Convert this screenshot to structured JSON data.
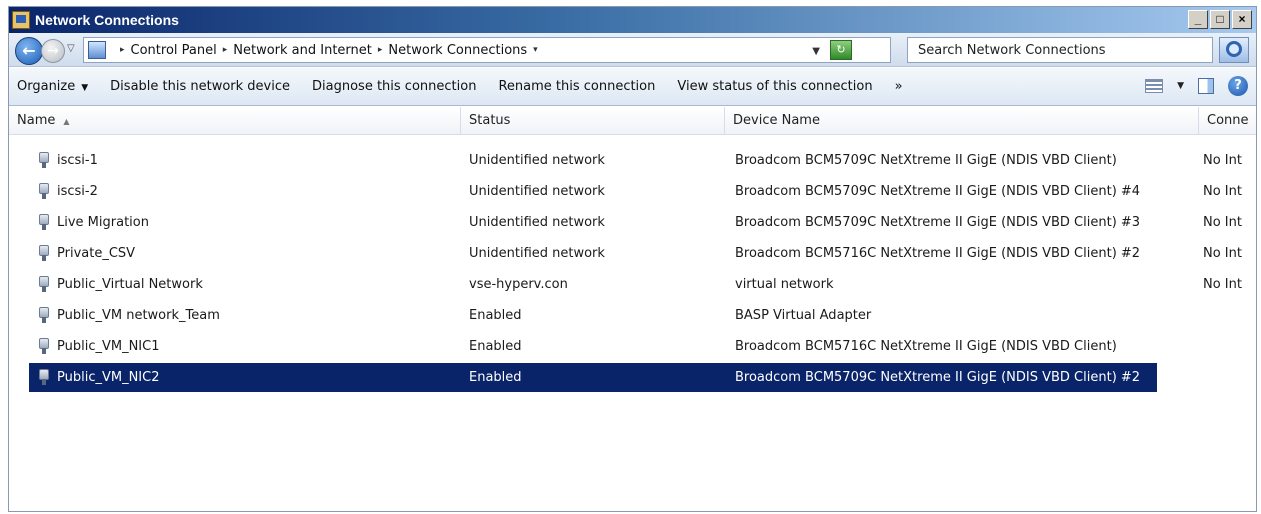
{
  "window": {
    "title": "Network Connections",
    "buttons": {
      "minimize": "_",
      "maximize": "□",
      "close": "×"
    }
  },
  "address": {
    "back_glyph": "←",
    "forward_glyph": "→",
    "breadcrumbs": [
      "Control Panel",
      "Network and Internet",
      "Network Connections"
    ],
    "search_placeholder": "Search Network Connections"
  },
  "commands": {
    "organize": "Organize",
    "disable": "Disable this network device",
    "diagnose": "Diagnose this connection",
    "rename": "Rename this connection",
    "view_status": "View status of this connection",
    "more": "»",
    "help": "?"
  },
  "columns": {
    "name": "Name",
    "status": "Status",
    "device": "Device Name",
    "connectivity": "Conne"
  },
  "connections": [
    {
      "name": "iscsi-1",
      "status": "Unidentified network",
      "device": "Broadcom BCM5709C NetXtreme II GigE (NDIS VBD Client)",
      "connectivity": "No Int",
      "selected": false
    },
    {
      "name": "iscsi-2",
      "status": "Unidentified network",
      "device": "Broadcom BCM5709C NetXtreme II GigE (NDIS VBD Client) #4",
      "connectivity": "No Int",
      "selected": false
    },
    {
      "name": "Live Migration",
      "status": "Unidentified network",
      "device": "Broadcom BCM5709C NetXtreme II GigE (NDIS VBD Client) #3",
      "connectivity": "No Int",
      "selected": false
    },
    {
      "name": "Private_CSV",
      "status": "Unidentified network",
      "device": "Broadcom BCM5716C NetXtreme II GigE (NDIS VBD Client) #2",
      "connectivity": "No Int",
      "selected": false
    },
    {
      "name": "Public_Virtual Network",
      "status": "vse-hyperv.con",
      "device": "virtual network",
      "connectivity": "No Int",
      "selected": false
    },
    {
      "name": "Public_VM network_Team",
      "status": "Enabled",
      "device": "BASP Virtual Adapter",
      "connectivity": "",
      "selected": false
    },
    {
      "name": "Public_VM_NIC1",
      "status": "Enabled",
      "device": "Broadcom BCM5716C NetXtreme II GigE (NDIS VBD Client)",
      "connectivity": "",
      "selected": false
    },
    {
      "name": "Public_VM_NIC2",
      "status": "Enabled",
      "device": "Broadcom BCM5709C NetXtreme II GigE (NDIS VBD Client) #2",
      "connectivity": "",
      "selected": true
    }
  ],
  "colors": {
    "selection": "#0a246a",
    "title_gradient_start": "#0a246a"
  }
}
